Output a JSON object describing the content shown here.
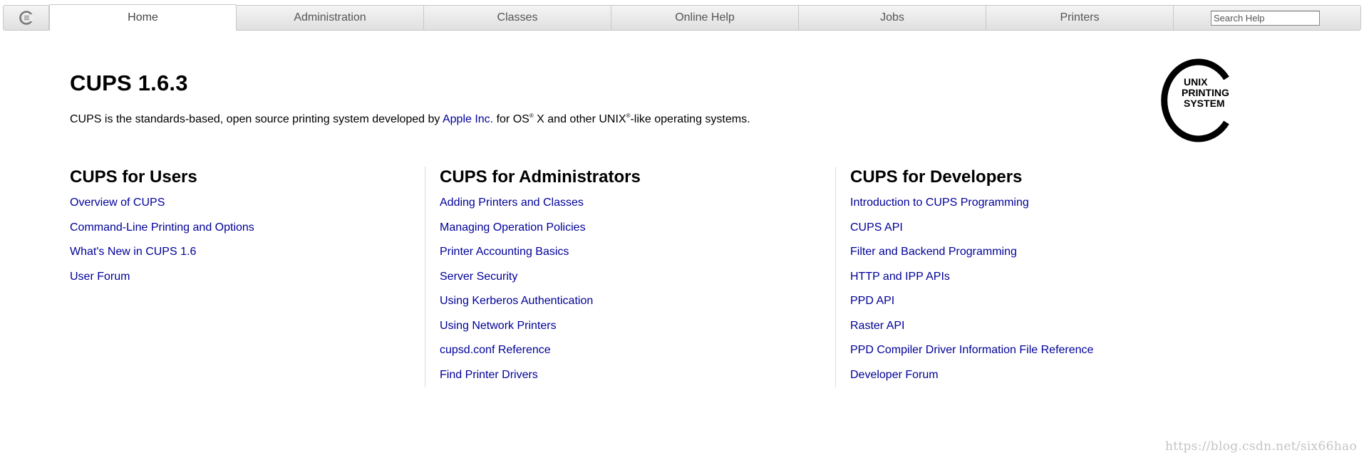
{
  "nav": {
    "tabs": [
      {
        "label": "Home",
        "active": true
      },
      {
        "label": "Administration",
        "active": false
      },
      {
        "label": "Classes",
        "active": false
      },
      {
        "label": "Online Help",
        "active": false
      },
      {
        "label": "Jobs",
        "active": false
      },
      {
        "label": "Printers",
        "active": false
      }
    ],
    "search": {
      "placeholder": "Search Help",
      "value": ""
    }
  },
  "header": {
    "title": "CUPS 1.6.3",
    "intro": {
      "before_link": "CUPS is the standards-based, open source printing system developed by ",
      "link": "Apple Inc.",
      "mid1": " for OS",
      "sup1": "®",
      "mid2": " X and other UNIX",
      "sup2": "®",
      "after": "-like operating systems."
    },
    "logo_lines": [
      "UNIX",
      "PRINTING",
      "SYSTEM"
    ]
  },
  "users": {
    "heading": "CUPS for Users",
    "links": [
      "Overview of CUPS",
      "Command-Line Printing and Options",
      "What's New in CUPS 1.6",
      "User Forum"
    ]
  },
  "admins": {
    "heading": "CUPS for Administrators",
    "links": [
      "Adding Printers and Classes",
      "Managing Operation Policies",
      "Printer Accounting Basics",
      "Server Security",
      "Using Kerberos Authentication",
      "Using Network Printers",
      "cupsd.conf Reference",
      "Find Printer Drivers"
    ]
  },
  "devs": {
    "heading": "CUPS for Developers",
    "links": [
      "Introduction to CUPS Programming",
      "CUPS API",
      "Filter and Backend Programming",
      "HTTP and IPP APIs",
      "PPD API",
      "Raster API",
      "PPD Compiler Driver Information File Reference",
      "Developer Forum"
    ]
  },
  "watermark": "https://blog.csdn.net/six66hao",
  "colors": {
    "link": "#000099",
    "nav_bg": "#e8e8e8",
    "divider": "#dddddd"
  }
}
